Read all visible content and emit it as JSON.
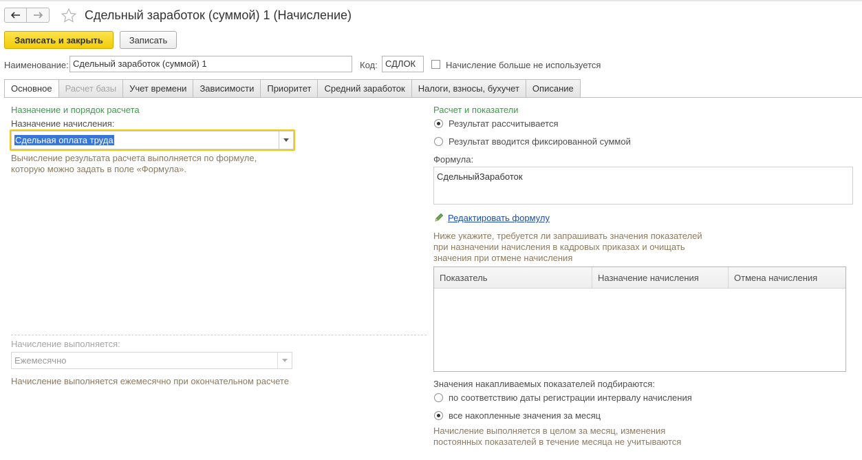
{
  "window": {
    "title": "Сдельный заработок (суммой) 1 (Начисление)"
  },
  "toolbar": {
    "save_close_label": "Записать и закрыть",
    "save_label": "Записать"
  },
  "header": {
    "name_label": "Наименование:",
    "name_value": "Сдельный заработок (суммой) 1",
    "code_label": "Код:",
    "code_value": "СДЛОК",
    "unused_checkbox_label": "Начисление больше не используется",
    "unused_checked": false
  },
  "tabs": [
    {
      "label": "Основное",
      "active": true,
      "disabled": false
    },
    {
      "label": "Расчет базы",
      "active": false,
      "disabled": true
    },
    {
      "label": "Учет времени",
      "active": false,
      "disabled": false
    },
    {
      "label": "Зависимости",
      "active": false,
      "disabled": false
    },
    {
      "label": "Приоритет",
      "active": false,
      "disabled": false
    },
    {
      "label": "Средний заработок",
      "active": false,
      "disabled": false
    },
    {
      "label": "Налоги, взносы, бухучет",
      "active": false,
      "disabled": false
    },
    {
      "label": "Описание",
      "active": false,
      "disabled": false
    }
  ],
  "left": {
    "section_title": "Назначение и порядок расчета",
    "purpose_label": "Назначение начисления:",
    "purpose_value": "Сдельная оплата труда",
    "purpose_hint_line1": "Вычисление результата расчета выполняется по формуле,",
    "purpose_hint_line2": "которую можно задать в поле «Формула».",
    "executes_label": "Начисление выполняется:",
    "executes_value": "Ежемесячно",
    "executes_hint": "Начисление выполняется ежемесячно при окончательном расчете"
  },
  "right": {
    "section_title": "Расчет и показатели",
    "radio_calculated": "Результат рассчитывается",
    "radio_fixed": "Результат вводится фиксированной суммой",
    "formula_label": "Формула:",
    "formula_value": "СдельныйЗаработок",
    "edit_formula_link": "Редактировать формулу",
    "indicators_hint_line1": "Ниже укажите, требуется ли запрашивать значения показателей",
    "indicators_hint_line2": "при назначении начисления в кадровых приказах и очищать",
    "indicators_hint_line3": "значения при отмене начисления",
    "table_columns": [
      "Показатель",
      "Назначение начисления",
      "Отмена начисления"
    ],
    "accumulated_label": "Значения накапливаемых показателей подбираются:",
    "radio_by_date": "по соответствию даты регистрации интервалу начисления",
    "radio_all_month": "все накопленные значения за месяц",
    "month_hint_line1": "Начисление выполняется в целом за месяц, изменения",
    "month_hint_line2": "постоянных показателей в течение месяца не учитываются"
  },
  "colors": {
    "accent_yellow": "#f3cc08",
    "section_green": "#3b9c4b",
    "hint_brown": "#8c7a5c",
    "link_blue": "#1a4ea6",
    "selection_blue": "#3875d7"
  }
}
